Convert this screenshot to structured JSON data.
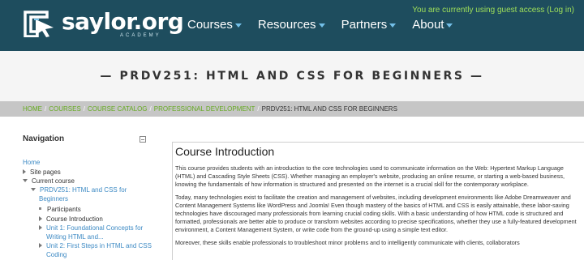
{
  "header": {
    "logo_text": "saylor.org",
    "logo_sub": "ACADEMY",
    "nav": [
      {
        "label": "Courses"
      },
      {
        "label": "Resources"
      },
      {
        "label": "Partners"
      },
      {
        "label": "About"
      }
    ],
    "guest_notice": "You are currently using guest access (Log in)"
  },
  "course_title": "— PRDV251: HTML AND CSS FOR BEGINNERS —",
  "breadcrumb": {
    "items": [
      "HOME",
      "COURSES",
      "COURSE CATALOG",
      "PROFESSIONAL DEVELOPMENT"
    ],
    "current": "PRDV251: HTML AND CSS FOR BEGINNERS",
    "separator": "/"
  },
  "navigation": {
    "title": "Navigation",
    "home": "Home",
    "site_pages": "Site pages",
    "current_course": "Current course",
    "course_line1": "PRDV251: HTML and CSS for",
    "course_line2": "Beginners",
    "participants": "Participants",
    "course_intro": "Course Introduction",
    "unit1_line1": "Unit 1: Foundational Concepts for",
    "unit1_line2": "Writing HTML and...",
    "unit2_line1": "Unit 2: First Steps in HTML and CSS",
    "unit2_line2": "Coding"
  },
  "main": {
    "heading": "Course Introduction",
    "paragraphs": [
      "This course provides students with an introduction to the core technologies used to communicate information on the Web: Hypertext Markup Language (HTML) and Cascading Style Sheets (CSS). Whether managing an employer's website, producing an online resume, or starting a web-based business, knowing the fundamentals of how information is structured and presented on the internet is a crucial skill for the contemporary workplace.",
      "Today, many technologies exist to facilitate the creation and management of websites, including development environments like Adobe Dreamweaver and Content Management Systems like WordPress and Joomla! Even though mastery of the basics of HTML and CSS is easily attainable, these labor-saving technologies have discouraged many professionals from learning crucial coding skills. With a basic understanding of how HTML code is structured and formatted, professionals are better able to produce or transform websites according to precise specifications, whether they use a fully-featured development environment, a Content Management System, or write code from the ground-up using a simple text editor.",
      "Moreover, these skills enable professionals to troubleshoot minor problems and to intelligently communicate with clients, collaborators"
    ]
  },
  "colors": {
    "header_bg": "#1e4d5e",
    "guest_text": "#9fe05a",
    "breadcrumb_link": "#66aa22",
    "nav_link": "#3d8ac4",
    "caret": "#74c0e8"
  },
  "icons": [
    "logo-mark-icon",
    "chevron-down-icon",
    "collapse-icon",
    "triangle-right-icon",
    "triangle-down-icon",
    "bullet-icon"
  ]
}
